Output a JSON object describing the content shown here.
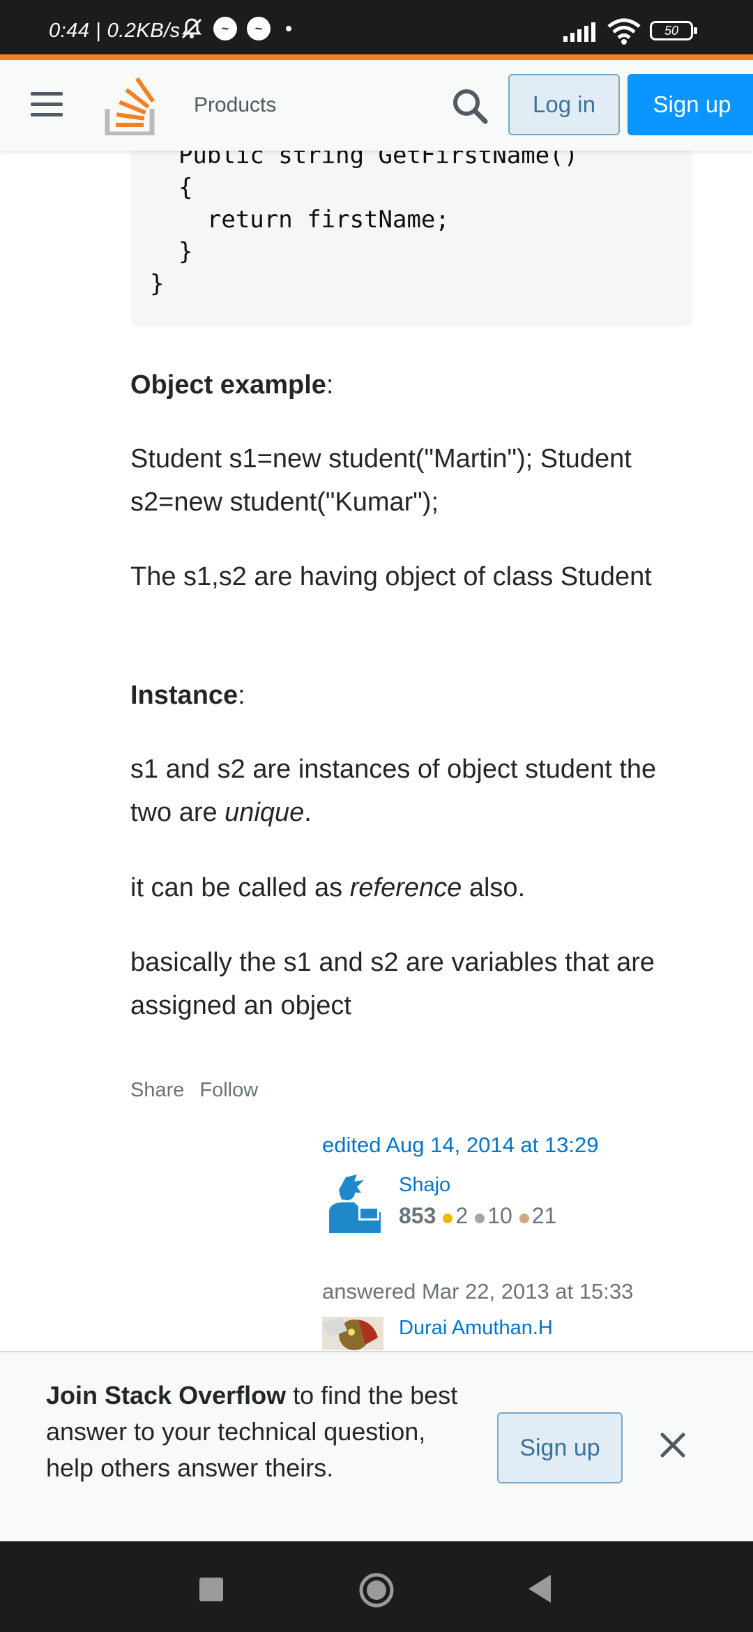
{
  "status_bar": {
    "time": "0:44 | 0.2KB/s",
    "battery": "50"
  },
  "header": {
    "products_label": "Products",
    "login_label": "Log in",
    "signup_label": "Sign up"
  },
  "code_lines": [
    "  Public string GetFirstName()",
    "  {",
    "    return firstName;",
    "  }",
    "}"
  ],
  "post": {
    "object_heading": "Object example",
    "object_code": "Student s1=new student(\"Martin\"); Student s2=new student(\"Kumar\");",
    "object_desc": "The s1,s2 are having object of class Student",
    "instance_heading": "Instance",
    "instance_desc_pre": "s1 and s2 are instances of object student the two are ",
    "instance_desc_em": "unique",
    "instance_desc_post": ".",
    "reference_pre": "it can be called as ",
    "reference_em": "reference",
    "reference_post": " also.",
    "variables_desc": "basically the s1 and s2 are variables that are assigned an object"
  },
  "post_menu": {
    "share": "Share",
    "follow": "Follow"
  },
  "editor": {
    "edited_text": "edited Aug 14, 2014 at 13:29",
    "name": "Shajo",
    "reputation": "853",
    "gold": "2",
    "silver": "10",
    "bronze": "21"
  },
  "answerer": {
    "answered_text": "answered Mar 22, 2013 at 15:33",
    "name": "Durai Amuthan.H"
  },
  "banner": {
    "bold": "Join Stack Overflow",
    "rest": " to find the best answer to your technical question, help others answer theirs.",
    "signup_label": "Sign up"
  },
  "colors": {
    "accent": "#f48024",
    "primary_button": "#0a95ff",
    "link": "#0074cc",
    "gold_badge": "#f1b600",
    "silver_badge": "#9fa6ad",
    "bronze_badge": "#d1a684"
  }
}
